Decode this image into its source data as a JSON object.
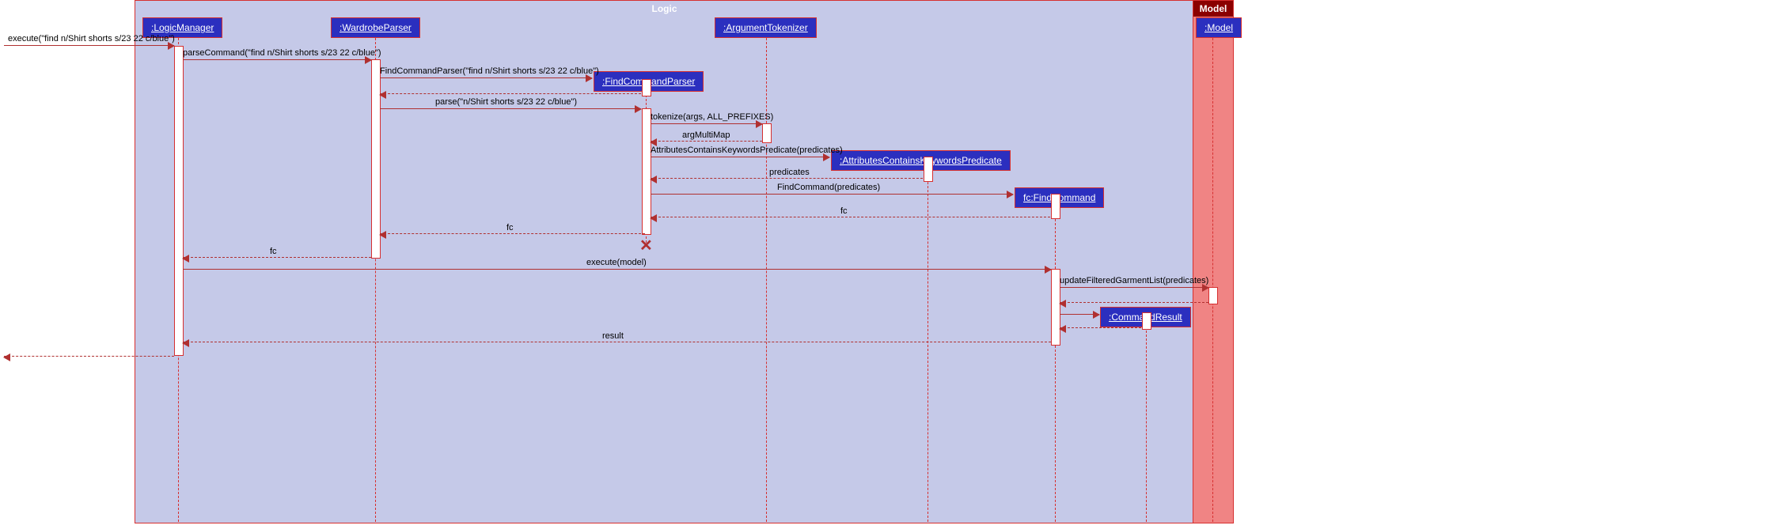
{
  "frames": {
    "logic": "Logic",
    "model": "Model"
  },
  "objects": {
    "lm": ":LogicManager",
    "wp": ":WardrobeParser",
    "at": ":ArgumentTokenizer",
    "fcp": ":FindCommandParser",
    "ackp": ":AttributesContainsKeywordsPredicate",
    "fc": "fc:FindCommand",
    "mdl": ":Model",
    "cr": ":CommandResult"
  },
  "messages": {
    "m1": "execute(\"find n/Shirt shorts s/23 22 c/blue\")",
    "m2": "parseCommand(\"find n/Shirt shorts s/23 22 c/blue\")",
    "m3": "FindCommandParser(\"find n/Shirt shorts s/23 22 c/blue\")",
    "m4": "parse(\"n/Shirt shorts s/23 22 c/blue\")",
    "m5": "tokenize(args, ALL_PREFIXES)",
    "m6": "argMultiMap",
    "m7": "AttributesContainsKeywordsPredicate(predicates)",
    "m8": "predicates",
    "m9": "FindCommand(predicates)",
    "m10": "fc",
    "m11": "fc",
    "m12": "fc",
    "m13": "execute(model)",
    "m14": "updateFilteredGarmentList(predicates)",
    "m15": "result"
  }
}
